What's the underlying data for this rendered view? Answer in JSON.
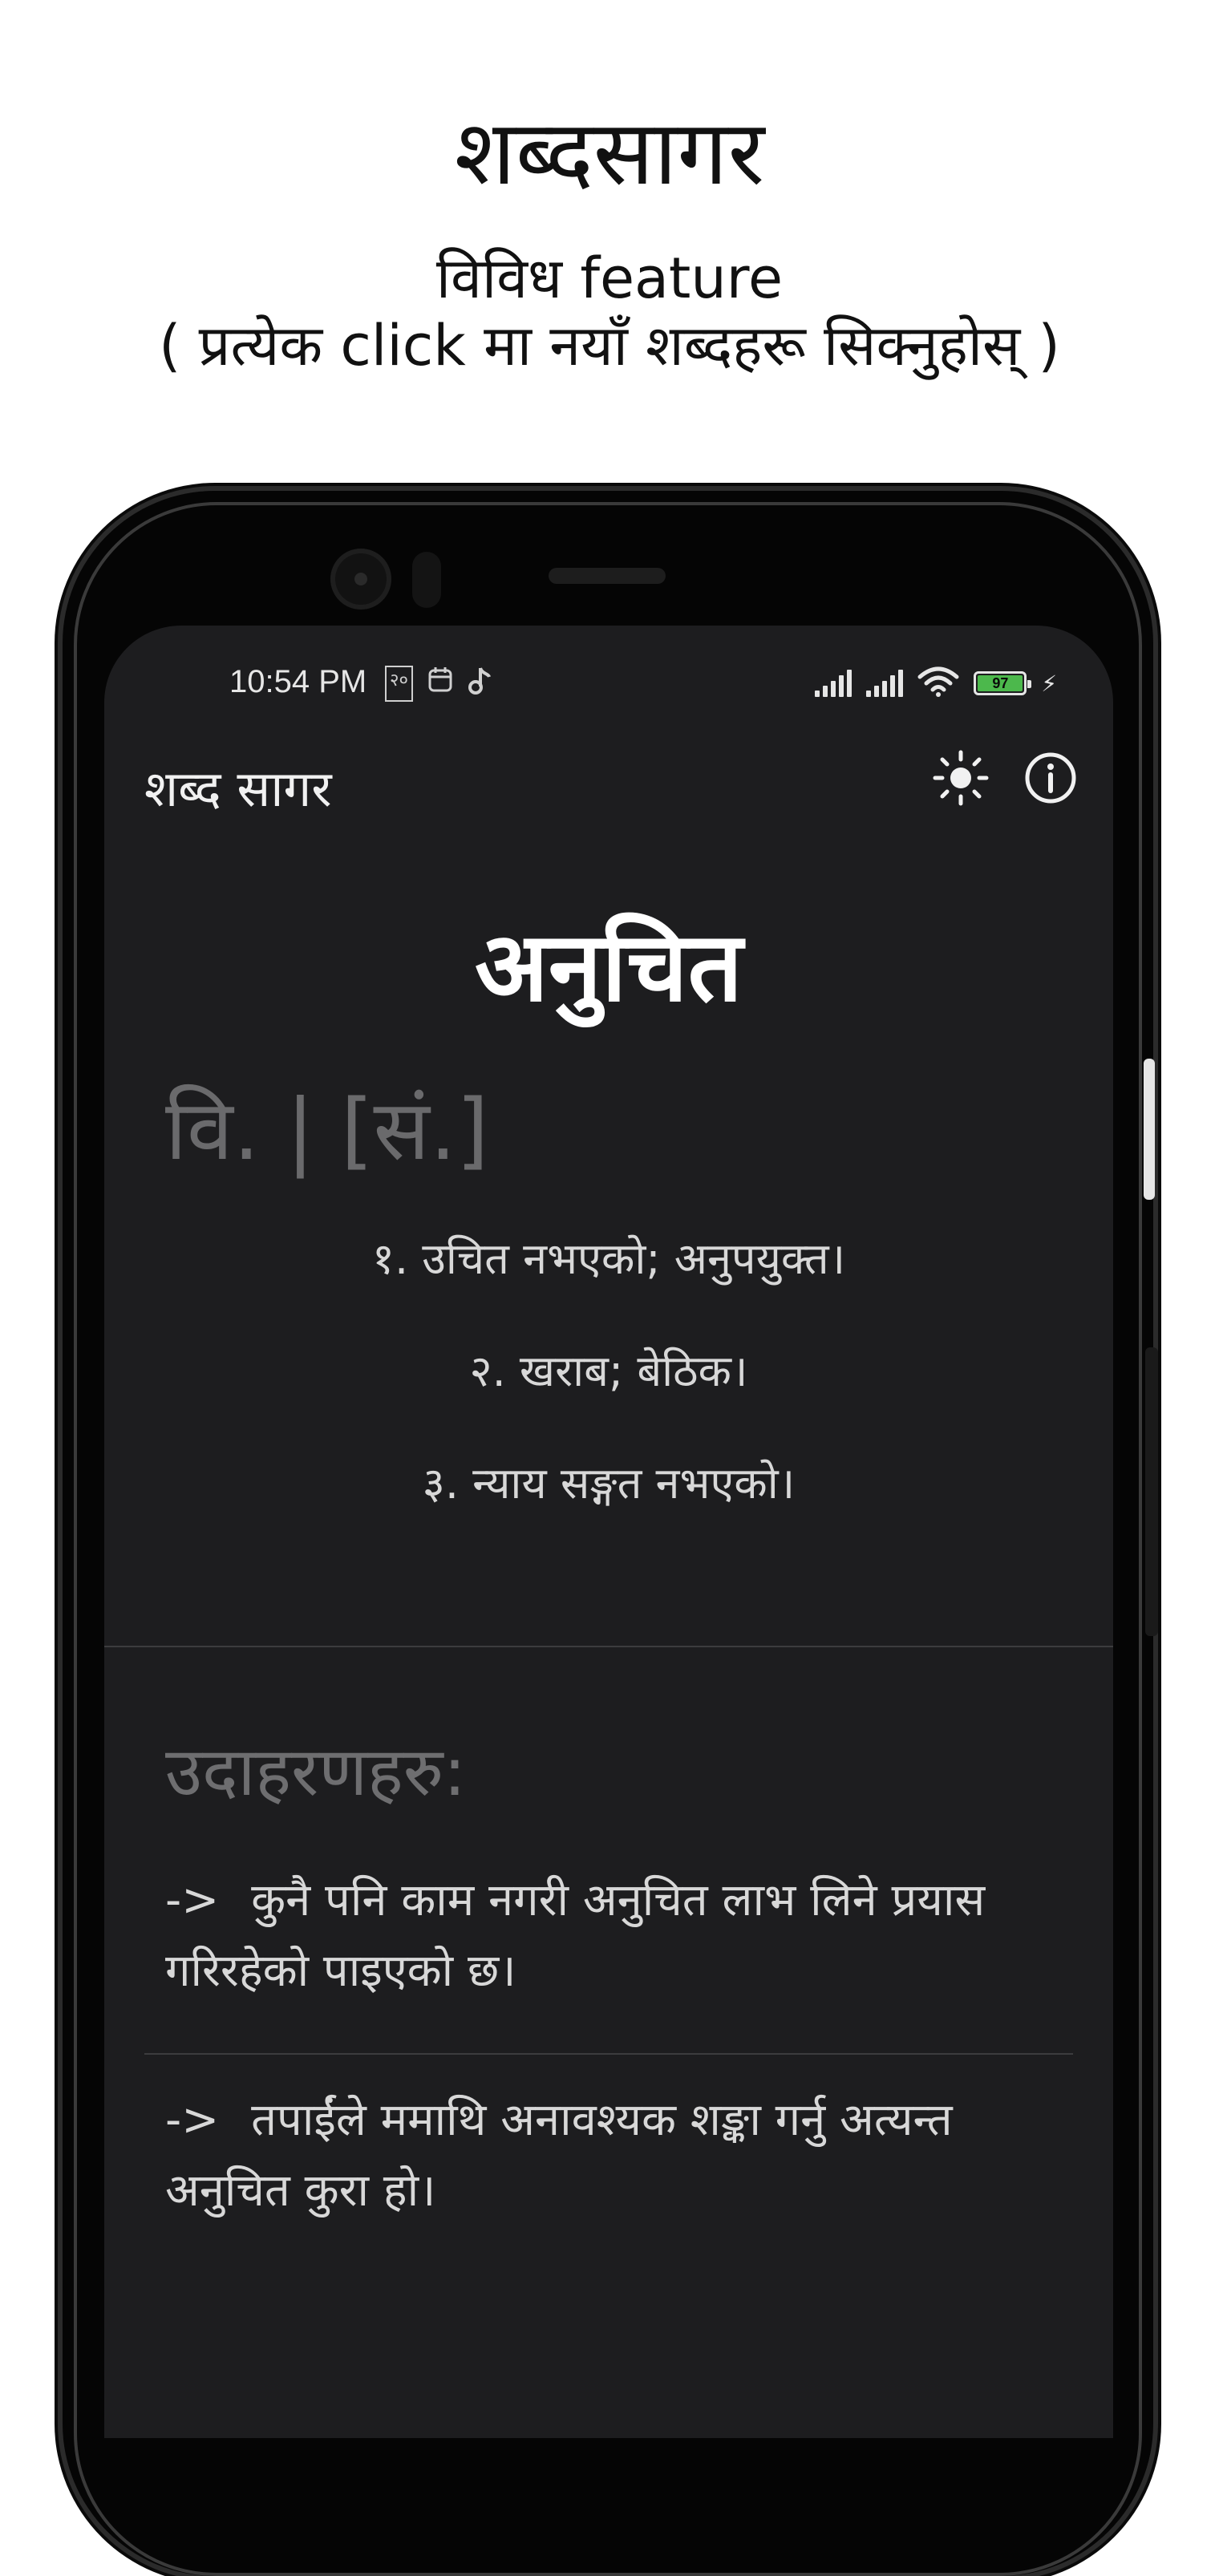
{
  "promo": {
    "title": "शब्दसागर",
    "subtitle_line1": "विविध feature",
    "subtitle_line2": "( प्रत्येक click मा नयाँ शब्दहरू सिक्नुहोस् )"
  },
  "status_bar": {
    "time": "10:54 PM",
    "notification_icons": [
      "२०",
      "calendar-icon",
      "music-note-icon"
    ],
    "battery_percent": "97",
    "colors": {
      "battery_fill": "#4cb84c"
    }
  },
  "app_bar": {
    "title": "शब्द सागर",
    "icons": [
      "brightness-icon",
      "info-icon"
    ]
  },
  "entry": {
    "word": "अनुचित",
    "grammar": "वि. | [सं.]",
    "meanings": [
      "१. उचित नभएको; अनुपयुक्त।",
      "२. खराब; बेठिक।",
      "३. न्याय सङ्गत नभएको।"
    ]
  },
  "examples": {
    "heading": "उदाहरणहरु:",
    "arrow": "->",
    "items": [
      "कुनै पनि काम नगरी अनुचित लाभ लिने प्रयास गरिरहेको पाइएको छ।",
      "तपाईंले ममाथि अनावश्यक शङ्का गर्नु अत्यन्त अनुचित कुरा हो।"
    ]
  }
}
